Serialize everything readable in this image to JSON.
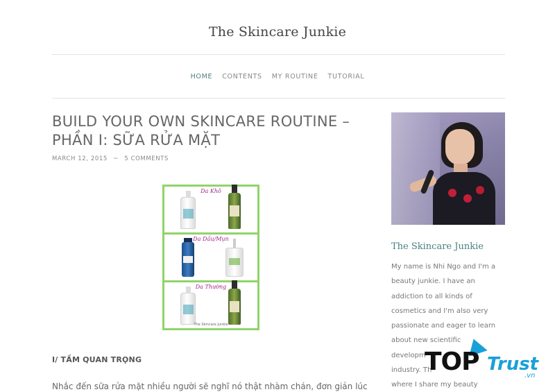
{
  "site": {
    "title": "The Skincare Junkie"
  },
  "nav": {
    "items": [
      {
        "label": "HOME",
        "active": true
      },
      {
        "label": "CONTENTS",
        "active": false
      },
      {
        "label": "MY ROUTINE",
        "active": false
      },
      {
        "label": "TUTORIAL",
        "active": false
      }
    ]
  },
  "post": {
    "title_line1": "BUILD YOUR OWN SKINCARE ROUTINE –",
    "title_line2": "PHẦN I: SỮA RỬA MẶT",
    "date": "MARCH 12, 2015",
    "separator": "~",
    "comments": "5 COMMENTS",
    "image": {
      "labels": [
        "Da Khô",
        "Da Dầu/Mụn",
        "Da Thường"
      ],
      "footer": "The Skincare Junkie"
    },
    "section_heading": "I/ TẦM QUAN TRỌNG",
    "body_start": "Nhắc đến sữa rửa mặt nhiều người sẽ nghĩ nó thật nhàm chán, đơn giản lúc"
  },
  "sidebar": {
    "widget_title": "The Skincare Junkie",
    "about_lines": [
      "My name is Nhi Ngo and I'm a",
      "beauty junkie. I have an",
      "addiction to all kinds of",
      "cosmetics and I'm also very",
      "passionate and eager to learn",
      "about new scientific",
      "developm",
      "industry. Th",
      "where I share my beauty"
    ]
  },
  "watermark": {
    "top": "TOP",
    "trust": "Trust",
    "vn": ".vn"
  },
  "colors": {
    "accent": "#4a7f80",
    "label_purple": "#a3298a",
    "collage_border": "#8fd46a",
    "watermark_blue": "#1aa0d8"
  }
}
